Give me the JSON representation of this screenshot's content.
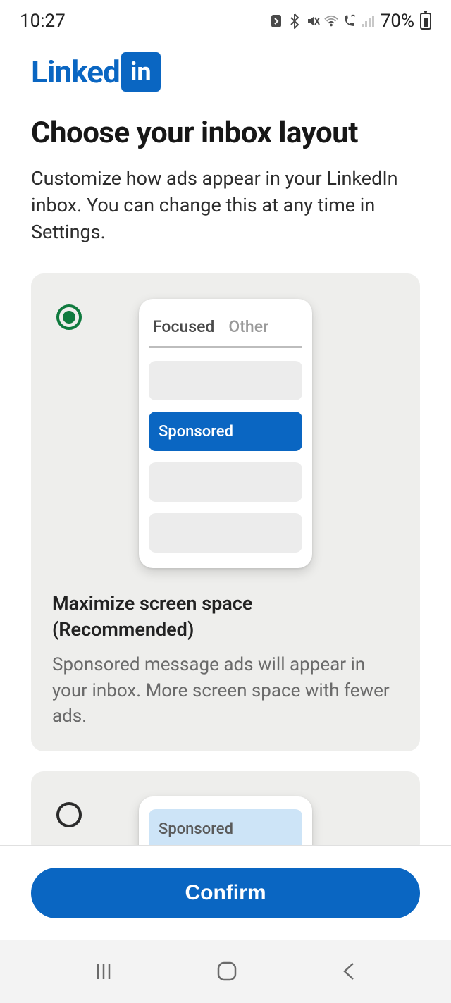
{
  "status": {
    "time": "10:27",
    "battery_text": "70%"
  },
  "logo": {
    "word": "Linked",
    "box": "in"
  },
  "header": {
    "title": "Choose your inbox layout",
    "subtitle": "Customize how ads appear in your LinkedIn inbox. You can change this at any time in Settings."
  },
  "option1": {
    "selected": true,
    "mockup": {
      "tab_active": "Focused",
      "tab_inactive": "Other",
      "sponsored_label": "Sponsored"
    },
    "title": "Maximize screen space (Recommended)",
    "desc": "Sponsored message ads will appear in your inbox. More screen space with fewer ads."
  },
  "option2": {
    "selected": false,
    "banner_label": "Sponsored"
  },
  "footer": {
    "confirm_label": "Confirm"
  }
}
